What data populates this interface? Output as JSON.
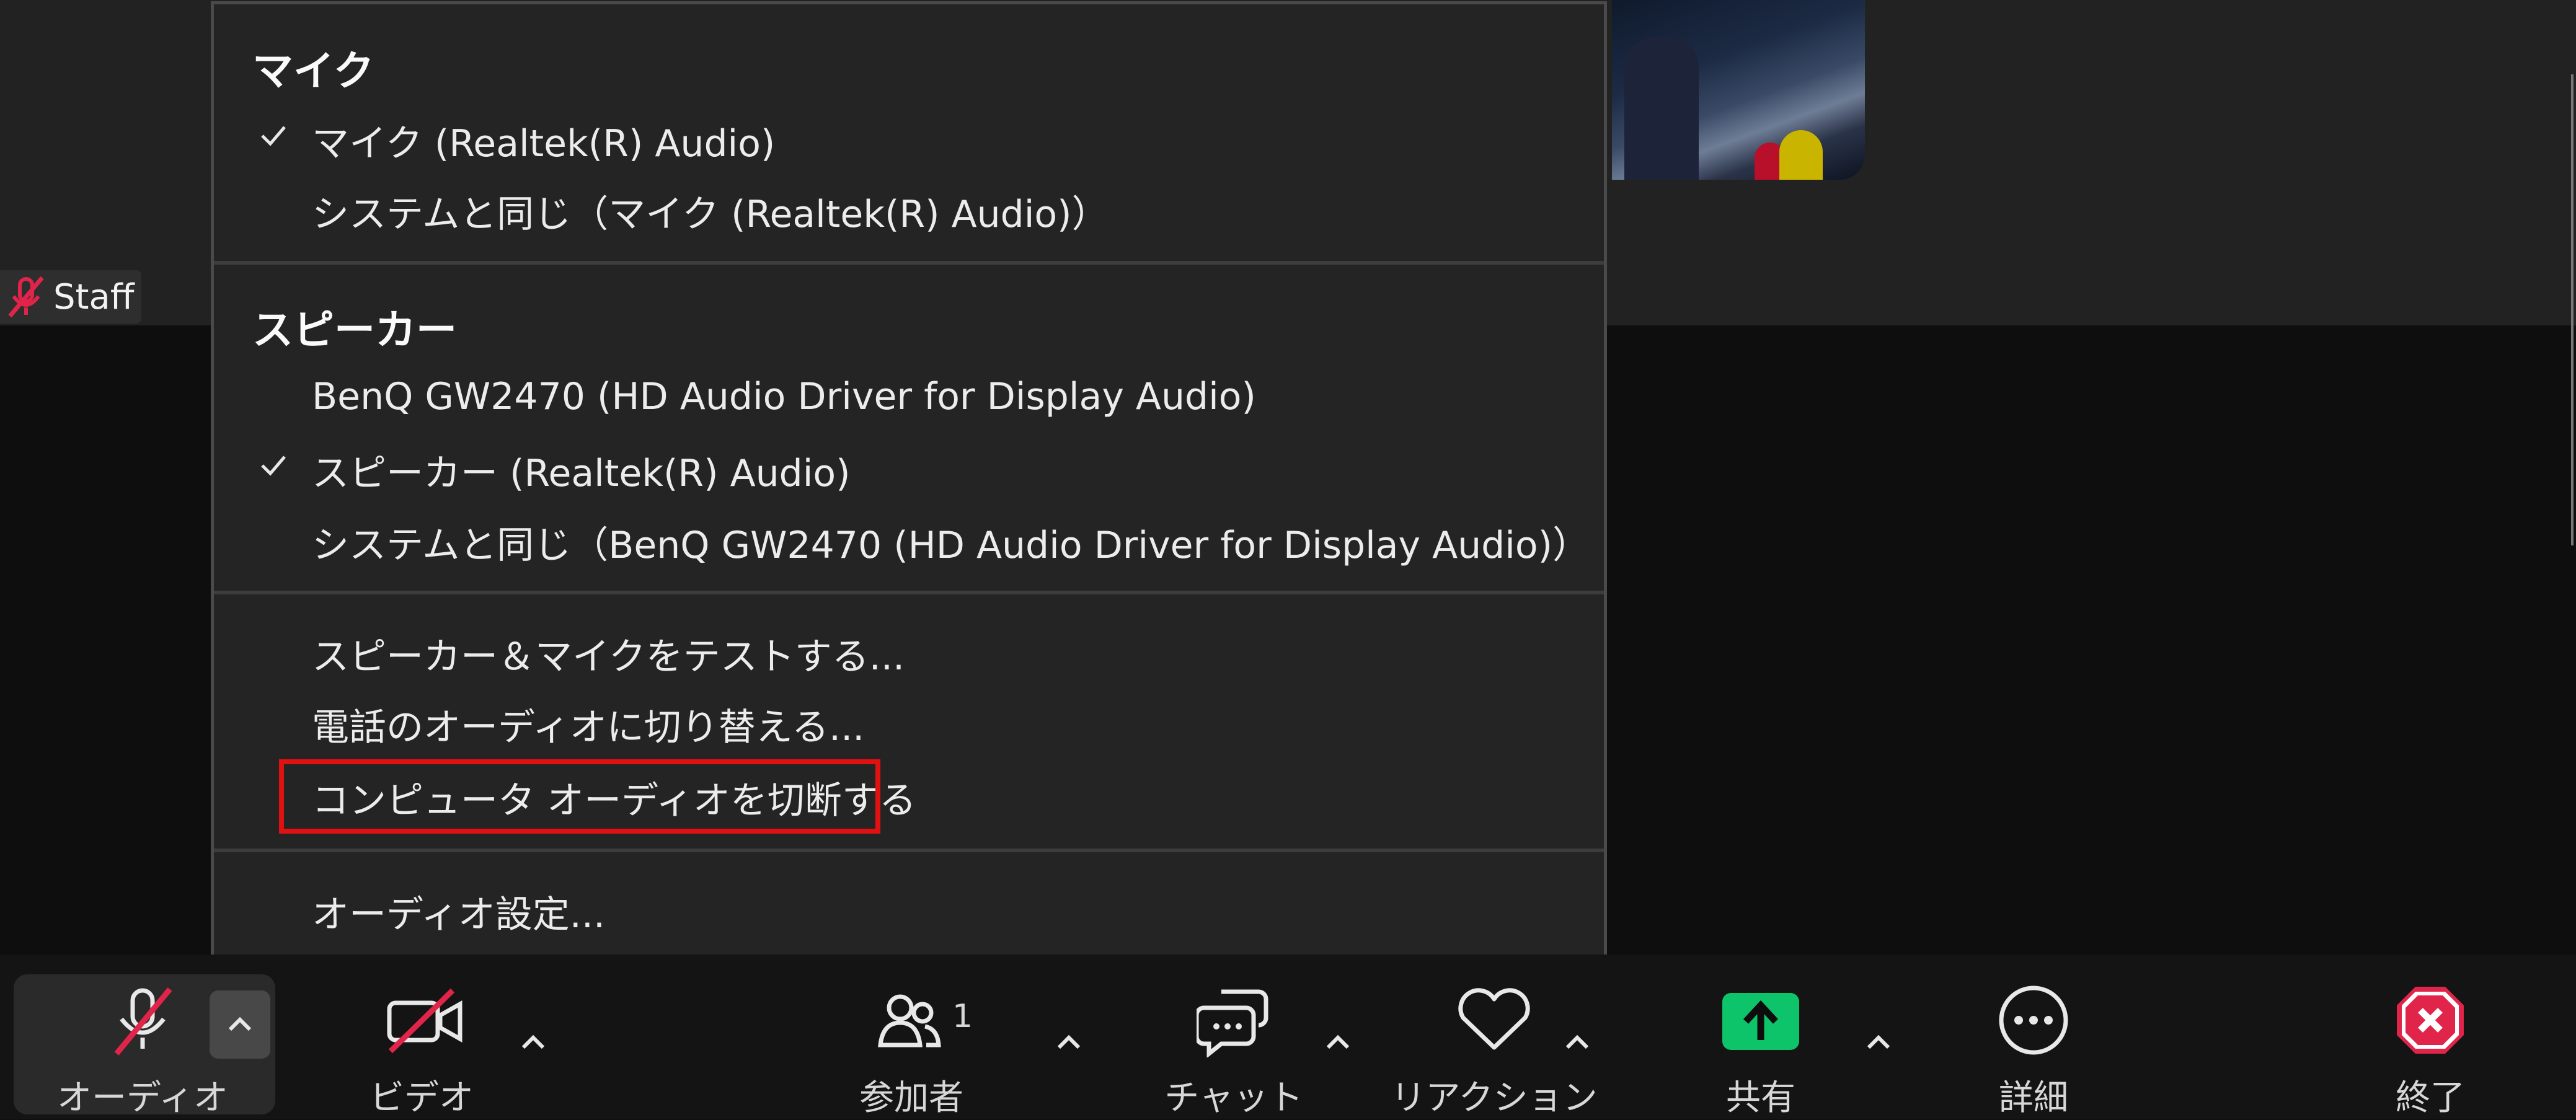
{
  "participant": {
    "name": "Staff"
  },
  "menu": {
    "mic_header": "マイク",
    "mic_items": [
      {
        "label": "マイク (Realtek(R) Audio)",
        "checked": true
      },
      {
        "label": "システムと同じ（マイク (Realtek(R) Audio)）",
        "checked": false
      }
    ],
    "speaker_header": "スピーカー",
    "speaker_items": [
      {
        "label": "BenQ GW2470 (HD Audio Driver for Display Audio)",
        "checked": false
      },
      {
        "label": "スピーカー (Realtek(R) Audio)",
        "checked": true
      },
      {
        "label": "システムと同じ（BenQ GW2470 (HD Audio Driver for Display Audio)）",
        "checked": false
      }
    ],
    "action_items": [
      "スピーカー＆マイクをテストする...",
      "電話のオーディオに切り替える...",
      "コンピュータ オーディオを切断する"
    ],
    "settings_item": "オーディオ設定..."
  },
  "toolbar": {
    "audio_label": "オーディオ",
    "video_label": "ビデオ",
    "participants_label": "参加者",
    "participants_count": "1",
    "chat_label": "チャット",
    "reaction_label": "リアクション",
    "share_label": "共有",
    "more_label": "詳細",
    "end_label": "終了"
  },
  "colors": {
    "highlight": "#e11111",
    "share_green": "#0ec46a",
    "end_red": "#e0244a",
    "mute_slash": "#e0244a"
  }
}
